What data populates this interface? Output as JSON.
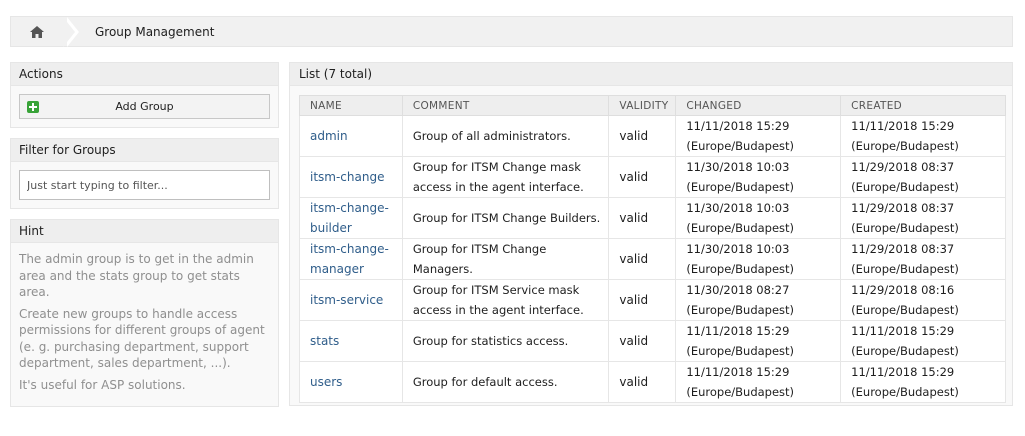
{
  "breadcrumb": {
    "home_icon": "home-icon",
    "title": "Group Management"
  },
  "actions": {
    "header": "Actions",
    "add_label": "Add Group"
  },
  "filter": {
    "header": "Filter for Groups",
    "placeholder": "Just start typing to filter..."
  },
  "hint": {
    "header": "Hint",
    "p1": "The admin group is to get in the admin area and the stats group to get stats area.",
    "p2": "Create new groups to handle access permissions for different groups of agent (e. g. purchasing department, support department, sales department, ...).",
    "p3": "It's useful for ASP solutions."
  },
  "list": {
    "header": "List (7 total)",
    "columns": [
      "NAME",
      "COMMENT",
      "VALIDITY",
      "CHANGED",
      "CREATED"
    ],
    "rows": [
      {
        "name_l1": "admin",
        "name_l2": "",
        "comment_l1": "Group of all administrators.",
        "comment_l2": "",
        "validity": "valid",
        "changed_l1": "11/11/2018 15:29",
        "changed_l2": "(Europe/Budapest)",
        "created_l1": "11/11/2018 15:29",
        "created_l2": "(Europe/Budapest)"
      },
      {
        "name_l1": "itsm-change",
        "name_l2": "",
        "comment_l1": "Group for ITSM Change mask",
        "comment_l2": "access in the agent interface.",
        "validity": "valid",
        "changed_l1": "11/30/2018 10:03",
        "changed_l2": "(Europe/Budapest)",
        "created_l1": "11/29/2018 08:37",
        "created_l2": "(Europe/Budapest)"
      },
      {
        "name_l1": "itsm-change-",
        "name_l2": "builder",
        "comment_l1": "Group for ITSM Change Builders.",
        "comment_l2": "",
        "validity": "valid",
        "changed_l1": "11/30/2018 10:03",
        "changed_l2": "(Europe/Budapest)",
        "created_l1": "11/29/2018 08:37",
        "created_l2": "(Europe/Budapest)"
      },
      {
        "name_l1": "itsm-change-",
        "name_l2": "manager",
        "comment_l1": "Group for ITSM Change Managers.",
        "comment_l2": "",
        "validity": "valid",
        "changed_l1": "11/30/2018 10:03",
        "changed_l2": "(Europe/Budapest)",
        "created_l1": "11/29/2018 08:37",
        "created_l2": "(Europe/Budapest)"
      },
      {
        "name_l1": "itsm-service",
        "name_l2": "",
        "comment_l1": "Group for ITSM Service mask",
        "comment_l2": "access in the agent interface.",
        "validity": "valid",
        "changed_l1": "11/30/2018 08:27",
        "changed_l2": "(Europe/Budapest)",
        "created_l1": "11/29/2018 08:16",
        "created_l2": "(Europe/Budapest)"
      },
      {
        "name_l1": "stats",
        "name_l2": "",
        "comment_l1": "Group for statistics access.",
        "comment_l2": "",
        "validity": "valid",
        "changed_l1": "11/11/2018 15:29",
        "changed_l2": "(Europe/Budapest)",
        "created_l1": "11/11/2018 15:29",
        "created_l2": "(Europe/Budapest)"
      },
      {
        "name_l1": "users",
        "name_l2": "",
        "comment_l1": "Group for default access.",
        "comment_l2": "",
        "validity": "valid",
        "changed_l1": "11/11/2018 15:29",
        "changed_l2": "(Europe/Budapest)",
        "created_l1": "11/11/2018 15:29",
        "created_l2": "(Europe/Budapest)"
      }
    ]
  },
  "colors": {
    "link": "#2f5d8a",
    "add_icon": "#38a338",
    "hint_text": "#8f8f8f"
  }
}
